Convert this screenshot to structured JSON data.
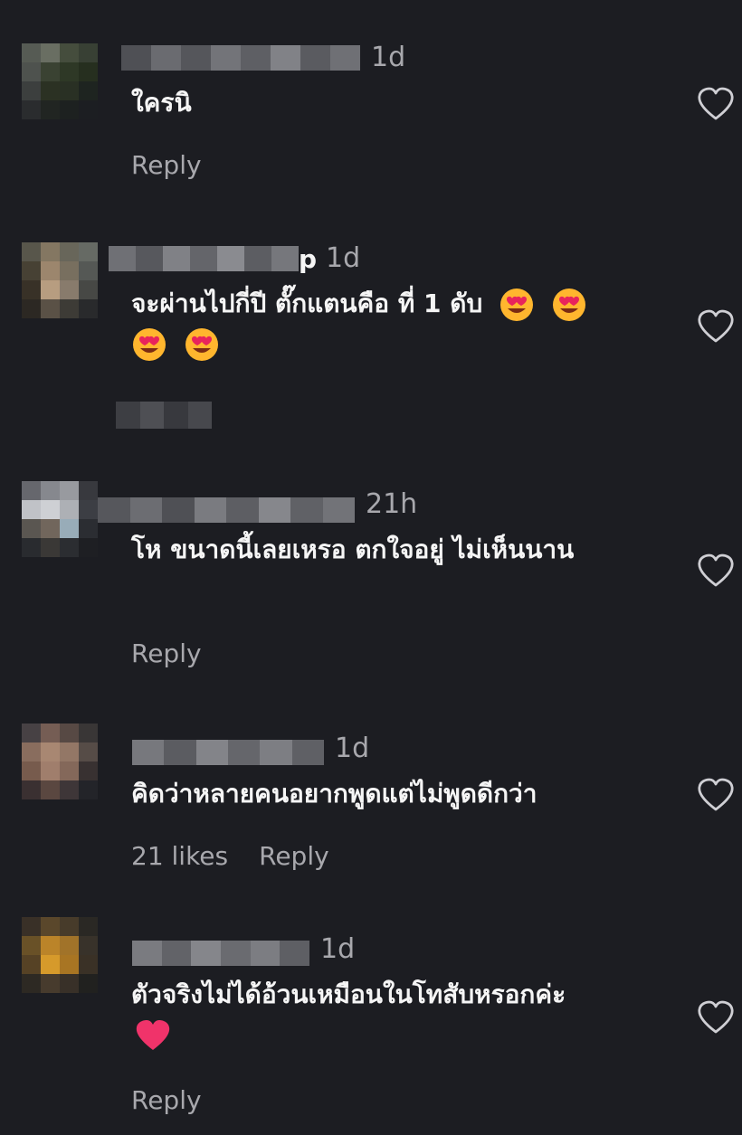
{
  "comments": [
    {
      "time": "1d",
      "name_visible_tail": "",
      "text": "ใครนิ",
      "reply_label": "Reply",
      "likes": "",
      "emojis": [],
      "emoji_line2": []
    },
    {
      "time": "1d",
      "name_visible_tail": "p",
      "text": "จะผ่านไปกี่ปี ตั๊กแตนคือ ที่ 1 ดับ",
      "reply_label": "",
      "likes": "",
      "emojis": [
        "heart-eyes",
        "heart-eyes"
      ],
      "emoji_line2": [
        "heart-eyes",
        "heart-eyes"
      ]
    },
    {
      "time": "21h",
      "name_visible_tail": "",
      "text": "โห ขนาดนี้เลยเหรอ ตกใจอยู่ ไม่เห็นนาน",
      "reply_label": "Reply",
      "likes": "",
      "emojis": [],
      "emoji_line2": []
    },
    {
      "time": "1d",
      "name_visible_tail": "",
      "text": "คิดว่าหลายคนอยากพูดแต่ไม่พูดดีกว่า",
      "reply_label": "Reply",
      "likes": "21 likes",
      "emojis": [],
      "emoji_line2": []
    },
    {
      "time": "1d",
      "name_visible_tail": "",
      "text": "ตัวจริงไม่ได้อ้วนเหมือนในโทสับหรอกค่ะ",
      "reply_label": "Reply",
      "likes": "",
      "emojis": [],
      "emoji_line2": [
        "red-heart"
      ]
    }
  ],
  "icons": {
    "like": "heart-outline-icon",
    "heart_eyes": "smiling-face-with-heart-eyes",
    "red_heart": "red-heart-emoji"
  },
  "colors": {
    "background": "#1c1d22",
    "text": "#f5f5f5",
    "muted": "#a8a8ad",
    "heart_outline": "#cfcfd4",
    "red_heart": "#f0336a"
  }
}
